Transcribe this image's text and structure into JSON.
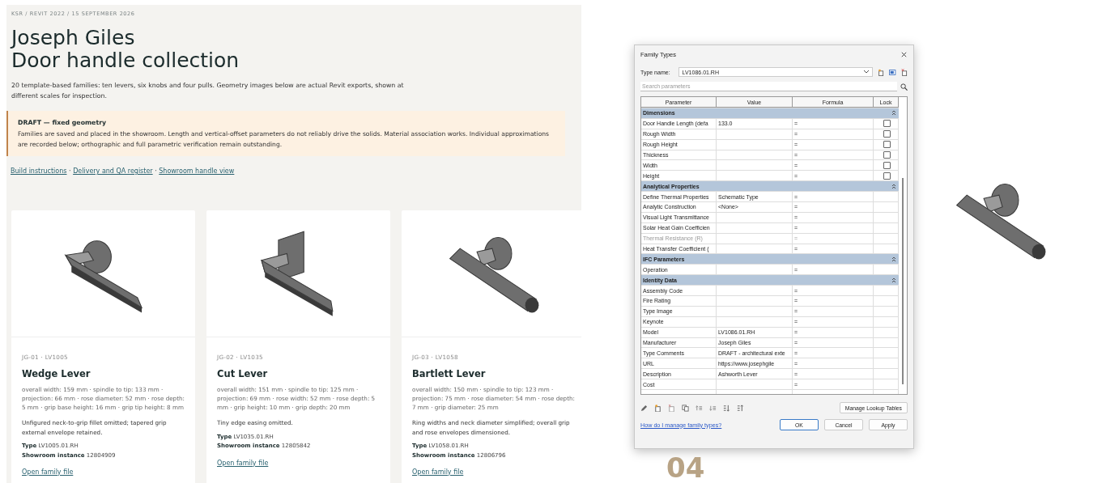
{
  "breadcrumb": "KSR / REVIT 2022 / 15 SEPTEMBER 2026",
  "title_lines": [
    "Joseph Giles",
    "Door handle collection"
  ],
  "intro": "20 template-based families: ten levers, six knobs and four pulls. Geometry images below are actual Revit exports, shown at different scales for inspection.",
  "notice": {
    "title": "DRAFT — fixed geometry",
    "body": "Families are saved and placed in the showroom. Length and vertical-offset parameters do not reliably drive the solids. Material association works. Individual approximations are recorded below; orthographic and full parametric verification remain outstanding."
  },
  "links": [
    "Build instructions",
    "Delivery and QA register",
    "Showroom handle view"
  ],
  "link_separator": "·",
  "cards": [
    {
      "kind": "wedge",
      "code": "JG-01 · LV1005",
      "name": "Wedge Lever",
      "dims": "overall width: 159 mm · spindle to tip: 133 mm · projection: 66 mm · rose diameter: 52 mm · rose depth: 5 mm · grip base height: 16 mm · grip tip height: 8 mm",
      "note": "Unfigured neck-to-grip fillet omitted; tapered grip external envelope retained.",
      "type_label": "Type",
      "type": "LV1005.01.RH",
      "instance_label": "Showroom instance",
      "instance": "12804909",
      "link": "Open family file"
    },
    {
      "kind": "square",
      "code": "JG-02 · LV1035",
      "name": "Cut Lever",
      "dims": "overall width: 151 mm · spindle to tip: 125 mm · projection: 69 mm · rose width: 52 mm · rose depth: 5 mm · grip height: 10 mm · grip depth: 20 mm",
      "note": "Tiny edge easing omitted.",
      "type_label": "Type",
      "type": "LV1035.01.RH",
      "instance_label": "Showroom instance",
      "instance": "12805842",
      "link": "Open family file"
    },
    {
      "kind": "round",
      "code": "JG-03 · LV1058",
      "name": "Bartlett Lever",
      "dims": "overall width: 150 mm · spindle to tip: 123 mm · projection: 75 mm · rose diameter: 54 mm · rose depth: 7 mm · grip diameter: 25 mm",
      "note": "Ring widths and neck diameter simplified; overall grip and rose envelopes dimensioned.",
      "type_label": "Type",
      "type": "LV1058.01.RH",
      "instance_label": "Showroom instance",
      "instance": "12806796",
      "link": "Open family file"
    }
  ],
  "dialog": {
    "title": "Family Types",
    "type_label": "Type name:",
    "type_value": "LV1086.01.RH",
    "search_placeholder": "Search parameters",
    "columns": [
      "Parameter",
      "Value",
      "Formula",
      "Lock"
    ],
    "groups": [
      {
        "name": "Dimensions",
        "rows": [
          {
            "name": "Door Handle Length (defa",
            "value": "133.0",
            "formula": "=",
            "disabled": false,
            "locked": false
          },
          {
            "name": "Rough Width",
            "formula": "=",
            "disabled": false,
            "locked": false
          },
          {
            "name": "Rough Height",
            "formula": "=",
            "disabled": false,
            "locked": false
          },
          {
            "name": "Thickness",
            "formula": "=",
            "disabled": false,
            "locked": false
          },
          {
            "name": "Width",
            "formula": "=",
            "disabled": false,
            "locked": false
          },
          {
            "name": "Height",
            "formula": "=",
            "disabled": false,
            "locked": false
          }
        ]
      },
      {
        "name": "Analytical Properties",
        "rows": [
          {
            "name": "Define Thermal Properties",
            "value": "Schematic Type",
            "formula": "=",
            "disabled": false
          },
          {
            "name": "Analytic Construction",
            "value": "<None>",
            "formula": "=",
            "disabled": false
          },
          {
            "name": "Visual Light Transmittance",
            "formula": "=",
            "disabled": false
          },
          {
            "name": "Solar Heat Gain Coefficien",
            "formula": "=",
            "disabled": false
          },
          {
            "name": "Thermal Resistance (R)",
            "formula": "=",
            "disabled": true
          },
          {
            "name": "Heat Transfer Coefficient (",
            "formula": "=",
            "disabled": false
          }
        ]
      },
      {
        "name": "IFC Parameters",
        "rows": [
          {
            "name": "Operation",
            "formula": "=",
            "disabled": false
          }
        ]
      },
      {
        "name": "Identity Data",
        "rows": [
          {
            "name": "Assembly Code",
            "formula": "=",
            "disabled": false
          },
          {
            "name": "Fire Rating",
            "formula": "=",
            "disabled": false
          },
          {
            "name": "Type Image",
            "formula": "=",
            "disabled": false
          },
          {
            "name": "Keynote",
            "formula": "=",
            "disabled": false
          },
          {
            "name": "Model",
            "value": "LV1086.01.RH",
            "formula": "=",
            "disabled": false
          },
          {
            "name": "Manufacturer",
            "value": "Joseph Giles",
            "formula": "=",
            "disabled": false
          },
          {
            "name": "Type Comments",
            "value": "DRAFT - architectural exte",
            "formula": "=",
            "disabled": false
          },
          {
            "name": "URL",
            "value": "https://www.josephgile",
            "formula": "=",
            "disabled": false
          },
          {
            "name": "Description",
            "value": "Ashworth Lever",
            "formula": "=",
            "disabled": false
          },
          {
            "name": "Cost",
            "formula": "=",
            "disabled": false
          }
        ]
      }
    ],
    "lookup_button": "Manage Lookup Tables",
    "help_link": "How do I manage family types?",
    "buttons": [
      {
        "label": "OK",
        "default": true
      },
      {
        "label": "Cancel",
        "default": false
      },
      {
        "label": "Apply",
        "default": false
      }
    ]
  },
  "section_number": "04"
}
